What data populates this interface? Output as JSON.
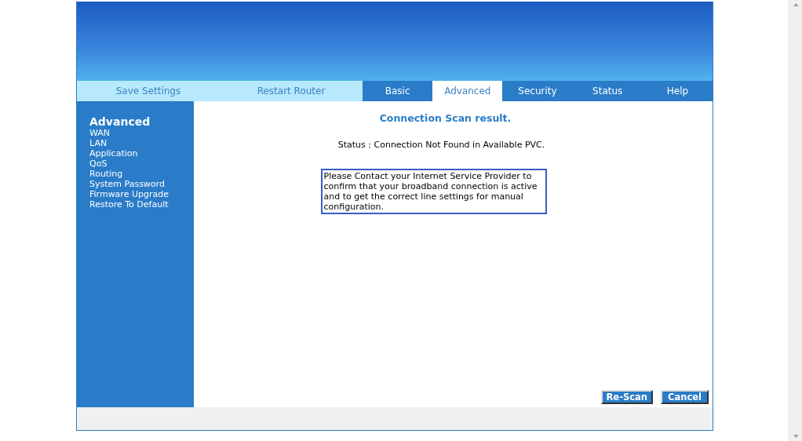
{
  "quick_links": [
    {
      "label": "Save Settings"
    },
    {
      "label": "Restart Router"
    }
  ],
  "tabs": [
    {
      "label": "Basic",
      "selected": false
    },
    {
      "label": "Advanced",
      "selected": true
    },
    {
      "label": "Security",
      "selected": false
    },
    {
      "label": "Status",
      "selected": false
    },
    {
      "label": "Help",
      "selected": false
    }
  ],
  "sidebar": {
    "title": "Advanced",
    "items": [
      "WAN",
      "LAN",
      "Application",
      "QoS",
      "Routing",
      "System Password",
      "Firmware Upgrade",
      "Restore To Default"
    ]
  },
  "content": {
    "title": "Connection Scan result.",
    "status": "Status : Connection Not Found in Available PVC.",
    "notice": "Please Contact your Internet Service Provider to confirm that your broadband connection is active and to get the correct line settings for manual configuration."
  },
  "buttons": [
    {
      "label": "Re-Scan"
    },
    {
      "label": "Cancel"
    }
  ]
}
